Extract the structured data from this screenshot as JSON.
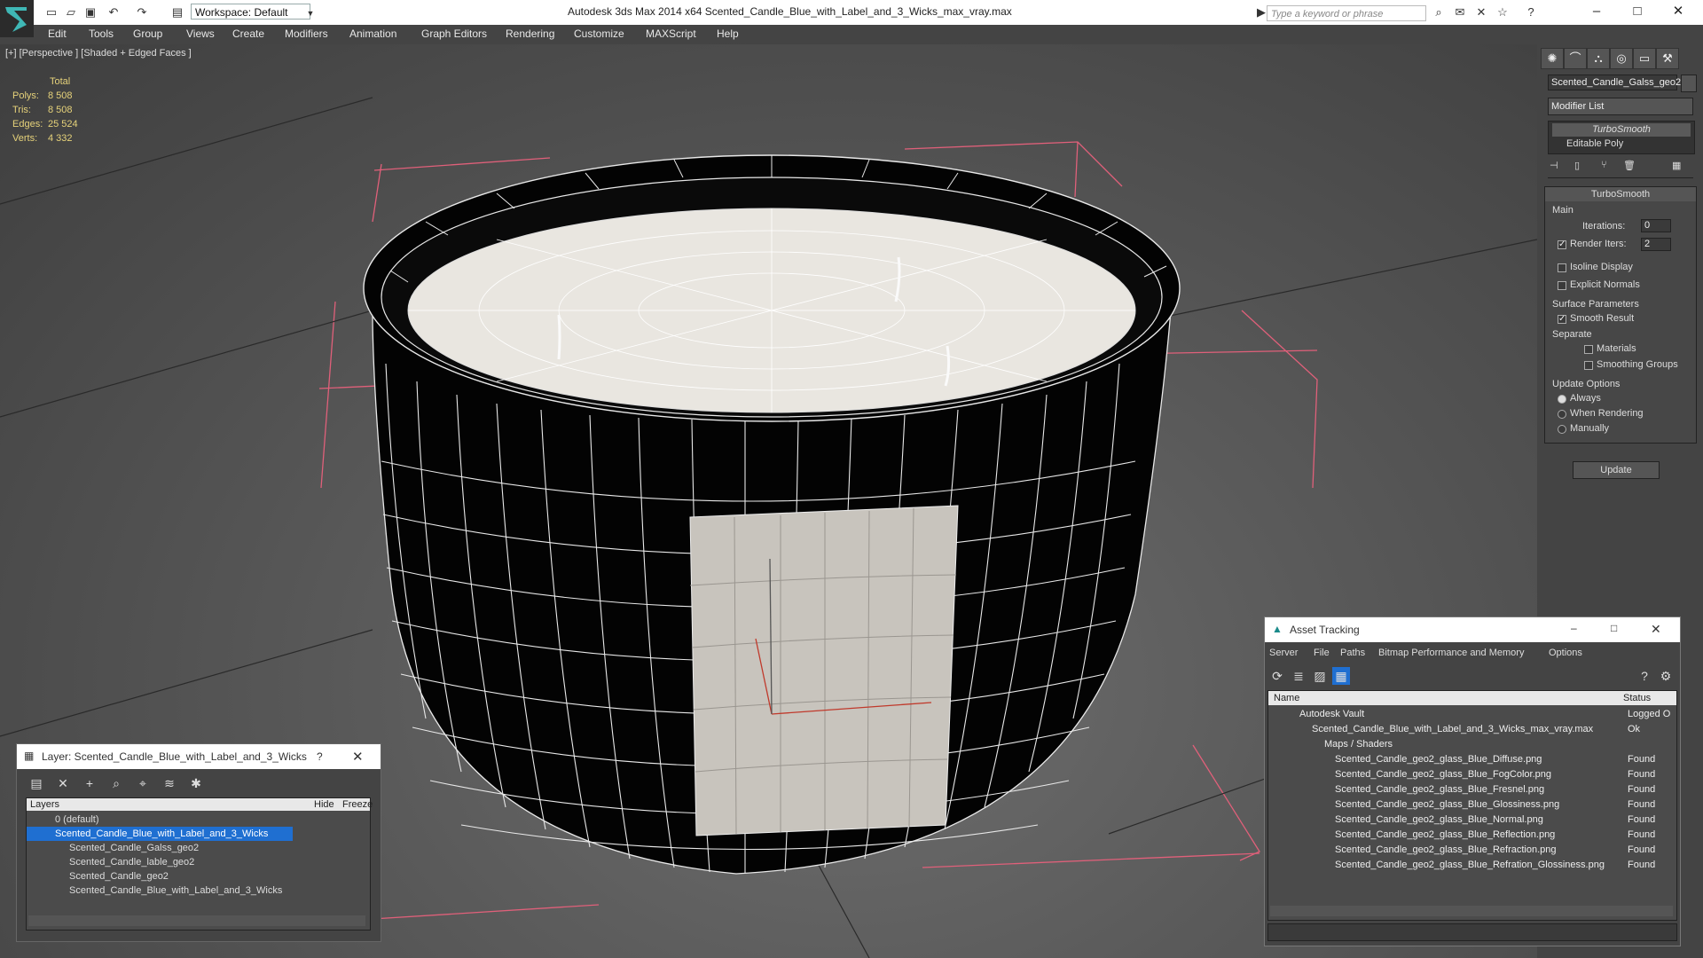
{
  "window": {
    "title": "Autodesk 3ds Max  2014 x64       Scented_Candle_Blue_with_Label_and_3_Wicks_max_vray.max",
    "workspace": "Workspace: Default",
    "search_placeholder": "Type a keyword or phrase"
  },
  "menu": [
    "Edit",
    "Tools",
    "Group",
    "Views",
    "Create",
    "Modifiers",
    "Animation",
    "Graph Editors",
    "Rendering",
    "Customize",
    "MAXScript",
    "Help"
  ],
  "viewport": {
    "label": "[+] [Perspective ] [Shaded + Edged Faces ]",
    "stats": {
      "header": "Total",
      "polys_label": "Polys:",
      "polys": "8 508",
      "tris_label": "Tris:",
      "tris": "8 508",
      "edges_label": "Edges:",
      "edges": "25 524",
      "verts_label": "Verts:",
      "verts": "4 332"
    }
  },
  "command_panel": {
    "object_name": "Scented_Candle_Galss_geo2",
    "modifier_list": "Modifier List",
    "stack": [
      "TurboSmooth",
      "Editable Poly"
    ],
    "rollout_title": "TurboSmooth",
    "main": "Main",
    "iterations_label": "Iterations:",
    "iterations": "0",
    "render_iters_label": "Render Iters:",
    "render_iters": "2",
    "isoline": "Isoline Display",
    "explicit_normals": "Explicit Normals",
    "surface_params": "Surface Parameters",
    "smooth_result": "Smooth Result",
    "separate": "Separate",
    "materials": "Materials",
    "smoothing_groups": "Smoothing Groups",
    "update_options": "Update Options",
    "always": "Always",
    "when_rendering": "When Rendering",
    "manually": "Manually",
    "update_button": "Update"
  },
  "layer_window": {
    "title": "Layer: Scented_Candle_Blue_with_Label_and_3_Wicks",
    "help": "?",
    "col_layers": "Layers",
    "col_hide": "Hide",
    "col_freeze": "Freeze",
    "rows": [
      "0 (default)",
      "Scented_Candle_Blue_with_Label_and_3_Wicks",
      "Scented_Candle_Galss_geo2",
      "Scented_Candle_lable_geo2",
      "Scented_Candle_geo2",
      "Scented_Candle_Blue_with_Label_and_3_Wicks"
    ]
  },
  "asset_tracking": {
    "title": "Asset Tracking",
    "menu": [
      "Server",
      "File",
      "Paths",
      "Bitmap Performance and Memory",
      "Options"
    ],
    "col_name": "Name",
    "col_status": "Status",
    "rows": [
      {
        "name": "Autodesk Vault",
        "status": "Logged O"
      },
      {
        "name": "Scented_Candle_Blue_with_Label_and_3_Wicks_max_vray.max",
        "status": "Ok"
      },
      {
        "name": "Maps / Shaders",
        "status": ""
      },
      {
        "name": "Scented_Candle_geo2_glass_Blue_Diffuse.png",
        "status": "Found"
      },
      {
        "name": "Scented_Candle_geo2_glass_Blue_FogColor.png",
        "status": "Found"
      },
      {
        "name": "Scented_Candle_geo2_glass_Blue_Fresnel.png",
        "status": "Found"
      },
      {
        "name": "Scented_Candle_geo2_glass_Blue_Glossiness.png",
        "status": "Found"
      },
      {
        "name": "Scented_Candle_geo2_glass_Blue_Normal.png",
        "status": "Found"
      },
      {
        "name": "Scented_Candle_geo2_glass_Blue_Reflection.png",
        "status": "Found"
      },
      {
        "name": "Scented_Candle_geo2_glass_Blue_Refraction.png",
        "status": "Found"
      },
      {
        "name": "Scented_Candle_geo2_glass_Blue_Refration_Glossiness.png",
        "status": "Found"
      }
    ]
  }
}
